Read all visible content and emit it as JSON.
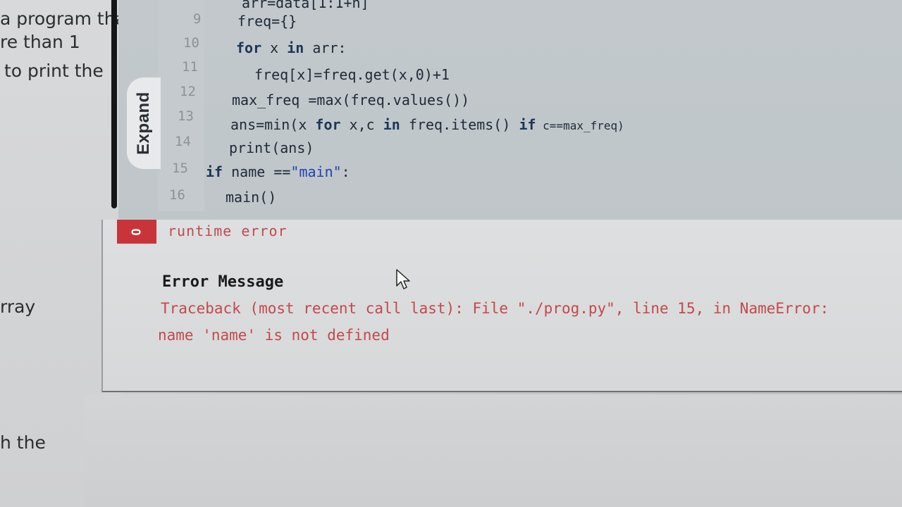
{
  "problem_panel": {
    "lines": [
      "a program that",
      "re than 1",
      "to print the",
      "rray",
      "h the"
    ]
  },
  "editor": {
    "expand_label": "Expand",
    "line_numbers": [
      "9",
      "10",
      "11",
      "12",
      "13",
      "14",
      "15",
      "16"
    ],
    "top_partial": "arr=data[1:1+n]",
    "code": {
      "l9": "freq={}",
      "l10_kw1": "for",
      "l10_a": " x ",
      "l10_kw2": "in",
      "l10_b": " arr:",
      "l11": "freq[x]=freq.get(x,0)+1",
      "l12": "max_freq =max(freq.values())",
      "l13_a": "ans=min(x ",
      "l13_kw1": "for",
      "l13_b": " x,c ",
      "l13_kw2": "in",
      "l13_c": " freq.items() ",
      "l13_kw3": "if",
      "l13_d": " c==max_freq)",
      "l14": "print(ans)",
      "l15_kw": "if",
      "l15_a": " name ==",
      "l15_str": "\"main\"",
      "l15_b": ":",
      "l16": "main()"
    }
  },
  "result": {
    "badge": "0",
    "status": "runtime error",
    "error_title": "Error Message",
    "error_line1": "Traceback (most recent call last): File \"./prog.py\", line 15, in NameError:",
    "error_line2": "name 'name' is not defined"
  },
  "colors": {
    "error_red": "#c8343a",
    "keyword": "#1c3558",
    "string": "#2042b0"
  }
}
